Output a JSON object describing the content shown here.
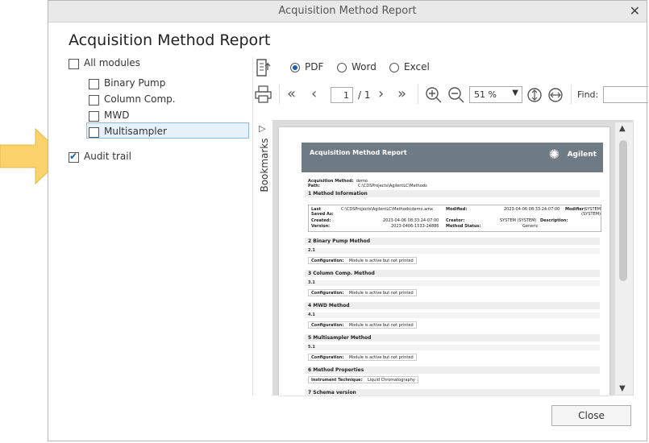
{
  "window": {
    "title": "Acquisition Method Report",
    "close_glyph": "✕"
  },
  "heading": "Acquisition Method Report",
  "modules": {
    "all_label": "All modules",
    "items": [
      {
        "label": "Binary Pump",
        "checked": false
      },
      {
        "label": "Column Comp.",
        "checked": false
      },
      {
        "label": "MWD",
        "checked": false
      },
      {
        "label": "Multisampler",
        "checked": false,
        "selected": true
      }
    ],
    "audit_label": "Audit trail",
    "audit_checked": true
  },
  "export": {
    "options": [
      "PDF",
      "Word",
      "Excel"
    ],
    "selected": "PDF"
  },
  "nav": {
    "page_current": "1",
    "page_total": "/ 1",
    "zoom": "51 %",
    "find_label": "Find:"
  },
  "bookmarks_label": "Bookmarks",
  "preview": {
    "banner_title": "Acquisition Method Report",
    "brand": "Agilent",
    "method_label": "Acquisition Method:",
    "method_value": "demo",
    "path_label": "Path:",
    "path_value": "C:\\CDSProjects\\AgilentLC\\Methods",
    "sec1": "1  Method Information",
    "last_label": "Last Saved As:",
    "last_value": "C:\\CDSProjects\\AgilentLC\\Methods\\demo.amx",
    "modified_label": "Modified:",
    "modified_value": "2023-04-06 08:33:24-07:00",
    "modifier_label": "Modifier:",
    "modifier_value": "SYSTEM (SYSTEM)",
    "created_label": "Created:",
    "created_value": "2023-04-06 08:33:24-07:00",
    "creator_label": "Creator:",
    "creator_value": "SYSTEM (SYSTEM)",
    "description_label": "Description:",
    "version_label": "Version:",
    "version_value": "2023-0406-1533-24886",
    "status_label": "Method Status:",
    "status_value": "Generic",
    "sections": [
      {
        "title": "2  Binary Pump Method",
        "sub": "2.1"
      },
      {
        "title": "3  Column Comp. Method",
        "sub": "3.1"
      },
      {
        "title": "4  MWD Method",
        "sub": "4.1"
      },
      {
        "title": "5  Multisampler Method",
        "sub": "5.1"
      }
    ],
    "config_label": "Configuration:",
    "config_value": "Module is active but not printed",
    "sec6": "6  Method Properties",
    "technique_label": "Instrument Technique:",
    "technique_value": "Liquid Chromatography",
    "sec7": "7  Schema version"
  },
  "close_button": "Close",
  "colors": {
    "accent": "#1a5ea8",
    "callout": "#f9d26a",
    "banner": "#6e7b85"
  }
}
